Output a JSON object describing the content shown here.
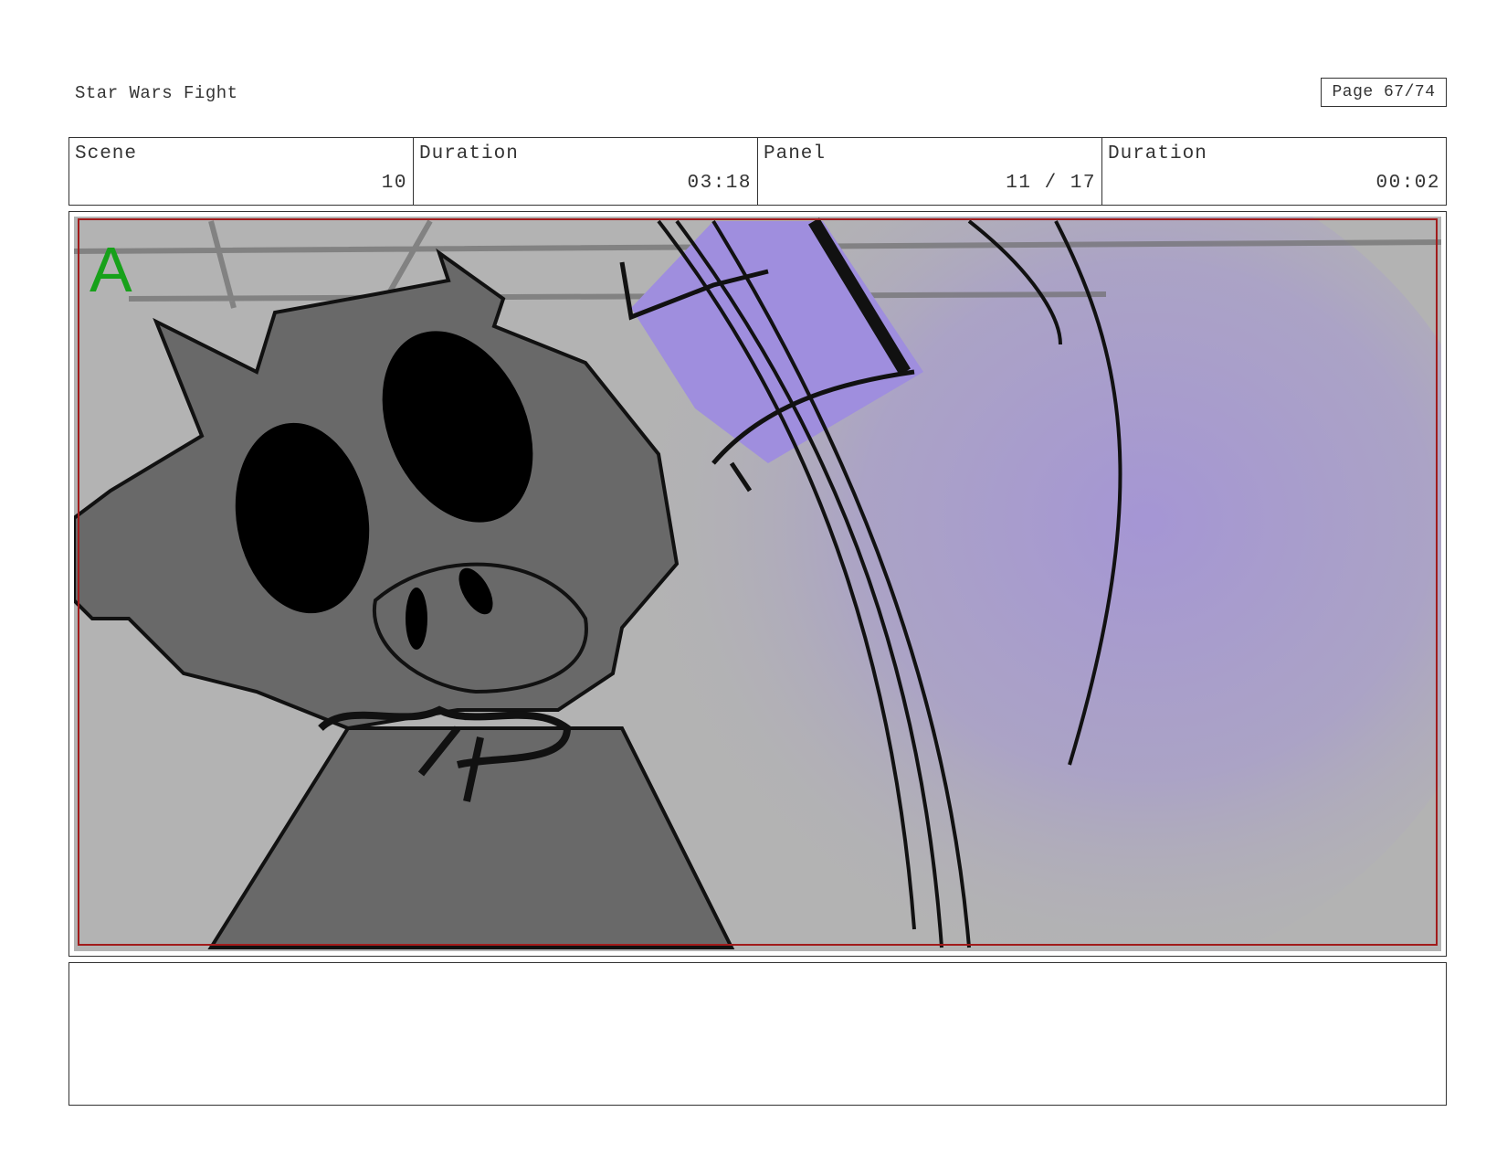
{
  "header": {
    "title": "Star Wars Fight",
    "page": "Page 67/74"
  },
  "info": {
    "scene_label": "Scene",
    "scene_value": "10",
    "scene_duration_label": "Duration",
    "scene_duration_value": "03:18",
    "panel_label": "Panel",
    "panel_value": "11 / 17",
    "panel_duration_label": "Duration",
    "panel_duration_value": "00:02"
  },
  "panel": {
    "letter": "A",
    "colors": {
      "background": "#b3b3b3",
      "glow": "#a494d6",
      "character": "#696969",
      "frame": "#a11b1b",
      "letter": "#17a11a"
    }
  },
  "notes": {
    "text": ""
  }
}
